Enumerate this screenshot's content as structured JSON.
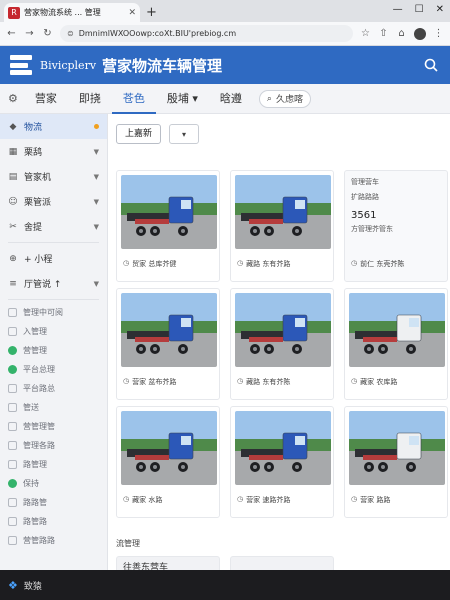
{
  "browser": {
    "tab_title": "营家物流系统 ... 管理",
    "new_tab": "+",
    "url": "DmnimlWXOOowp:coXt.BIU'prebiog.cm"
  },
  "header": {
    "brand": "Bivicplerv",
    "title": "营家物流车辆管理"
  },
  "nav": {
    "items": [
      {
        "label": "营家"
      },
      {
        "label": "即挠"
      },
      {
        "label": "苍色"
      },
      {
        "label": "殷埔 ▾"
      },
      {
        "label": "晗遵"
      }
    ],
    "search_label": "久虑喀"
  },
  "sidebar": {
    "items": [
      {
        "label": "物流",
        "icon": "layers-icon",
        "active": true
      },
      {
        "label": "栗鸹",
        "icon": "grid-icon"
      },
      {
        "label": "管家机",
        "icon": "document-icon"
      },
      {
        "label": "栗管派",
        "icon": "user-icon"
      },
      {
        "label": "舍提",
        "icon": "tools-icon"
      },
      {
        "label": "+ 小程",
        "icon": "plus-icon"
      },
      {
        "label": "厅管说 ↑",
        "icon": "stack-icon"
      }
    ],
    "subitems": [
      {
        "label": "管理中可阅"
      },
      {
        "label": "入管理"
      },
      {
        "label": "营管理"
      },
      {
        "label": "平台总理"
      },
      {
        "label": "平台路总"
      },
      {
        "label": "管送"
      },
      {
        "label": "营管理管"
      },
      {
        "label": "管理各路"
      },
      {
        "label": "路管理"
      },
      {
        "label": "保持"
      },
      {
        "label": "路路管"
      },
      {
        "label": "路管路"
      },
      {
        "label": "营管路路"
      }
    ]
  },
  "toolbar": {
    "new_label": "上嘉新",
    "dropdown_label": "▾"
  },
  "cards": [
    {
      "caption": "贸家 总库芥健",
      "truck": "blue"
    },
    {
      "caption": "藏路 东有芥路",
      "truck": "blue"
    },
    {
      "caption": "营家 盆布芥路",
      "truck": "blue"
    },
    {
      "caption": "藏路 东有芥陈",
      "truck": "blue"
    },
    {
      "caption": "藏家 农库路",
      "truck": "white"
    },
    {
      "caption": "藏家 水路",
      "truck": "blue"
    },
    {
      "caption": "营家 速路芥路",
      "truck": "blue"
    },
    {
      "caption": "营家 路路",
      "truck": "white"
    }
  ],
  "info_card": {
    "line1": "管理营车",
    "line2": "扩路路路",
    "value": "3561",
    "line3": "方管理芥管东",
    "caption": "前仁 东壳芥陈"
  },
  "section": {
    "title": "流管理",
    "partial_card": "往善东营车"
  },
  "taskbar": {
    "label": "致猿"
  },
  "colors": {
    "accent": "#2f6ac2",
    "truck_blue": "#2c58b8",
    "truck_white": "#eef0f2"
  }
}
